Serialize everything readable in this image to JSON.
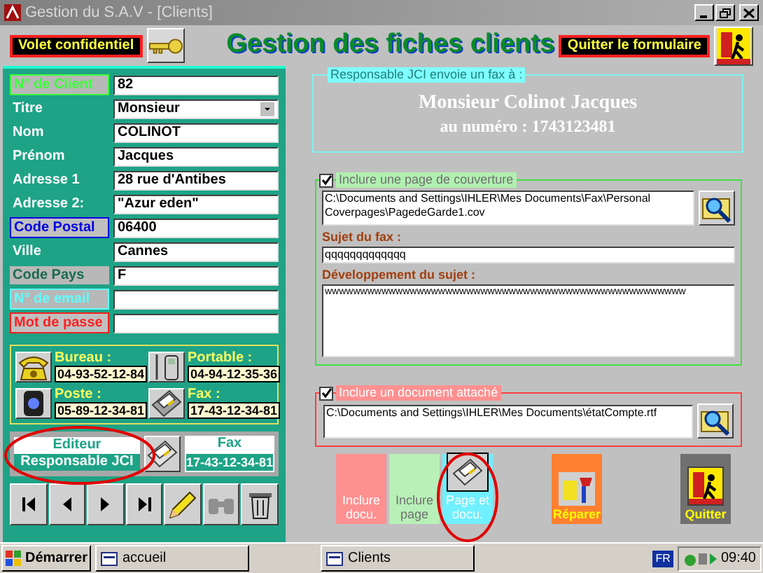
{
  "window": {
    "title": "Gestion du S.A.V - [Clients]"
  },
  "header": {
    "confidential_button": "Volet confidentiel",
    "title": "Gestion des fiches clients",
    "quit_button": "Quitter le formulaire"
  },
  "client_fields": [
    {
      "label": {
        "text": "N° de Client",
        "kind": "green"
      },
      "value": "82",
      "kind": "text"
    },
    {
      "label": {
        "text": "Titre",
        "kind": "plain"
      },
      "value": "Monsieur",
      "kind": "dropdown"
    },
    {
      "label": {
        "text": "Nom",
        "kind": "plain"
      },
      "value": "COLINOT",
      "kind": "text"
    },
    {
      "label": {
        "text": "Prénom",
        "kind": "plain"
      },
      "value": "Jacques",
      "kind": "text"
    },
    {
      "label": {
        "text": "Adresse 1",
        "kind": "plain"
      },
      "value": "28 rue d'Antibes",
      "kind": "text"
    },
    {
      "label": {
        "text": "Adresse 2:",
        "kind": "plain"
      },
      "value": "\"Azur eden\"",
      "kind": "text"
    },
    {
      "label": {
        "text": "Code Postal",
        "kind": "blue"
      },
      "value": "06400",
      "kind": "text"
    },
    {
      "label": {
        "text": "Ville",
        "kind": "plain"
      },
      "value": "Cannes",
      "kind": "text"
    },
    {
      "label": {
        "text": "Code Pays",
        "kind": "gray"
      },
      "value": "F",
      "kind": "text"
    },
    {
      "label": {
        "text": "N° de email",
        "kind": "cyan"
      },
      "kind": "text"
    },
    {
      "label": {
        "text": "Mot de passe",
        "kind": "red"
      },
      "kind": "text"
    }
  ],
  "phones": [
    {
      "label": "Bureau :",
      "value": "04-93-52-12-84",
      "kind": "desk"
    },
    {
      "label": "Portable :",
      "value": "04-94-12-35-36",
      "kind": "mobile"
    },
    {
      "label": "Poste :",
      "value": "05-89-12-34-81",
      "kind": "handset"
    },
    {
      "label": "Fax :",
      "value": "17-43-12-34-81",
      "kind": "fax"
    }
  ],
  "editor": {
    "heading": "Editeur",
    "value": "Responsable JCI"
  },
  "editor_fax": {
    "heading": "Fax",
    "value": "17-43-12-34-81"
  },
  "nav_buttons": [
    {
      "kind": "first"
    },
    {
      "kind": "prev"
    },
    {
      "kind": "next"
    },
    {
      "kind": "last"
    },
    {
      "kind": "edit"
    },
    {
      "kind": "find"
    },
    {
      "kind": "delete"
    }
  ],
  "recipient": {
    "legend": "Responsable JCI envoie un fax à :",
    "name": "Monsieur Colinot Jacques",
    "number": "au numéro : 1743123481"
  },
  "cover": {
    "checked": true,
    "legend": "Inclure une page de couverture",
    "path": "C:\\Documents and Settings\\IHLER\\Mes Documents\\Fax\\Personal Coverpages\\PagedeGarde1.cov",
    "subject_label": "Sujet du fax :",
    "subject": "qqqqqqqqqqqqq",
    "body_label": "Développement du sujet :",
    "body": "wwwwwwwwwwwwwwwwwwwwwwwwwwwwwwwwwwwwwwwwwwwwwwwwwww"
  },
  "attachment": {
    "checked": true,
    "legend": "Inclure un document attaché",
    "path": "C:\\Documents and Settings\\IHLER\\Mes Documents\\étatCompte.rtf"
  },
  "action_buttons": [
    {
      "label": "Inclure docu.",
      "kind": "doc"
    },
    {
      "label": "Inclure page",
      "kind": "page"
    },
    {
      "label": "Page et docu.",
      "kind": "both"
    },
    {
      "label": "Réparer",
      "kind": "repair"
    },
    {
      "label": "Quitter",
      "kind": "quit"
    }
  ],
  "taskbar": {
    "start": "Démarrer",
    "tasks": [
      "accueil",
      "Clients"
    ],
    "language": "FR",
    "clock": "09:40"
  }
}
